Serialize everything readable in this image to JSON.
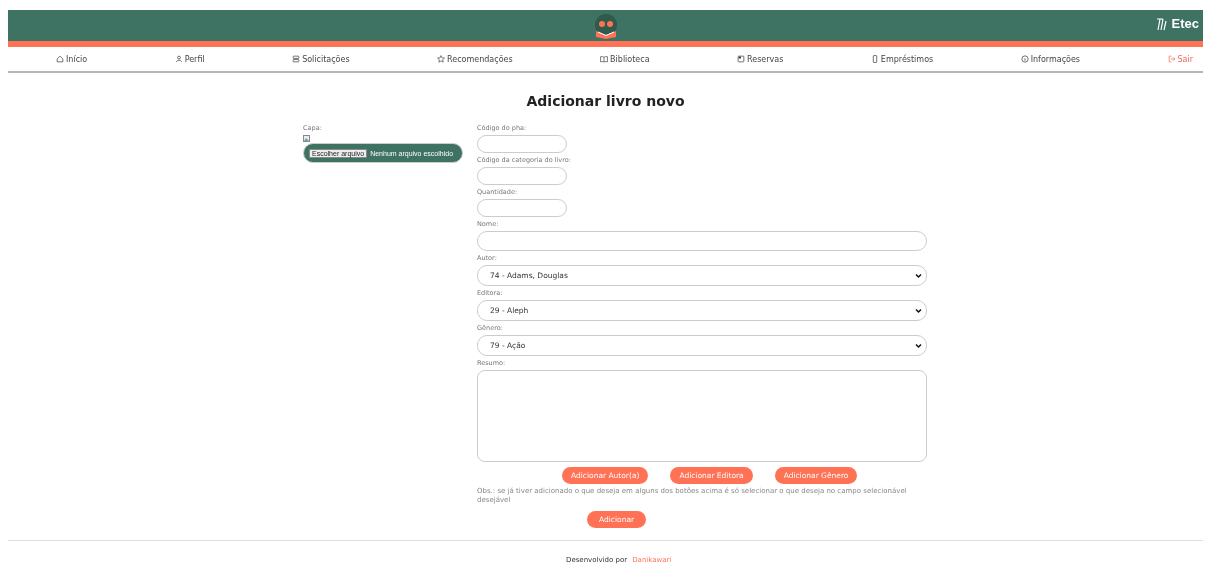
{
  "header": {
    "brand": "Etec"
  },
  "nav": [
    {
      "label": "Início",
      "kind": "link"
    },
    {
      "label": "Perfil",
      "kind": "link"
    },
    {
      "label": "Solicitações",
      "kind": "link"
    },
    {
      "label": "Recomendações",
      "kind": "link"
    },
    {
      "label": "Biblioteca",
      "kind": "link"
    },
    {
      "label": "Reservas",
      "kind": "link"
    },
    {
      "label": "Empréstimos",
      "kind": "link"
    },
    {
      "label": "Informações",
      "kind": "link"
    },
    {
      "label": "Sair",
      "kind": "exit"
    }
  ],
  "title": "Adicionar livro novo",
  "cover": {
    "label": "Capa:",
    "button": "Escolher arquivo",
    "status": "Nenhum arquivo escolhido"
  },
  "fields": [
    {
      "label": "Código do pha:",
      "kind": "short"
    },
    {
      "label": "Código da categoria do livro:",
      "kind": "short"
    },
    {
      "label": "Quantidade:",
      "kind": "short"
    },
    {
      "label": "Nome:",
      "kind": "wide"
    },
    {
      "label": "Autor:",
      "kind": "select",
      "value": "74 - Adams, Douglas"
    },
    {
      "label": "Editora:",
      "kind": "select",
      "value": "29 - Aleph"
    },
    {
      "label": "Gênero:",
      "kind": "select",
      "value": "79 - Ação"
    },
    {
      "label": "Resumo:",
      "kind": "textarea"
    }
  ],
  "add_buttons": [
    "Adicionar Autor(a)",
    "Adicionar Editora",
    "Adicionar Gênero"
  ],
  "note": "Obs.: se já tiver adicionado o que deseja em alguns dos botões acima é só selecionar o que deseja no campo selecionável desejável",
  "submit": "Adicionar",
  "footer": {
    "text": "Desenvolvido por",
    "link": "Danikawari"
  }
}
